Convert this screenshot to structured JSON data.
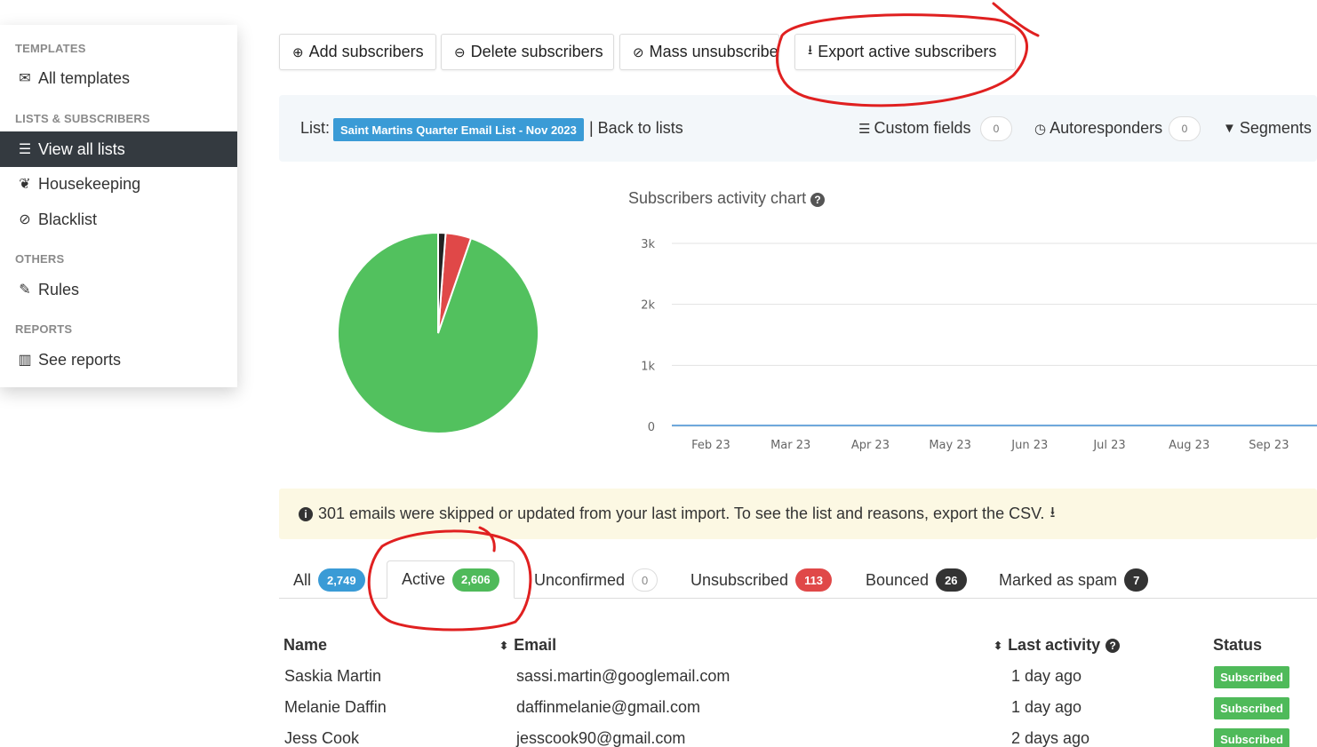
{
  "sidebar": {
    "sections": [
      {
        "heading": "TEMPLATES",
        "items": [
          {
            "label": "All templates",
            "icon": "envelope-icon"
          }
        ]
      },
      {
        "heading": "LISTS & SUBSCRIBERS",
        "items": [
          {
            "label": "View all lists",
            "icon": "list-icon",
            "active": true
          },
          {
            "label": "Housekeeping",
            "icon": "leaf-icon"
          },
          {
            "label": "Blacklist",
            "icon": "ban-icon"
          }
        ]
      },
      {
        "heading": "OTHERS",
        "items": [
          {
            "label": "Rules",
            "icon": "magic-wand-icon"
          }
        ]
      },
      {
        "heading": "REPORTS",
        "items": [
          {
            "label": "See reports",
            "icon": "bar-chart-icon"
          }
        ]
      }
    ]
  },
  "toolbar": {
    "add": "Add subscribers",
    "delete": "Delete subscribers",
    "mass_unsubscribe": "Mass unsubscribe",
    "export": "Export active subscribers"
  },
  "listbar": {
    "list_label": "List:",
    "list_name": "Saint Martins Quarter Email List - Nov 2023",
    "back": "| Back to lists",
    "custom_fields": "Custom fields",
    "custom_fields_count": "0",
    "autoresponders": "Autoresponders",
    "autoresponders_count": "0",
    "segments": "Segments"
  },
  "chart_data": [
    {
      "type": "pie",
      "categories": [
        "Active",
        "Unsubscribed",
        "Bounced + Marked as spam"
      ],
      "values": [
        2606,
        113,
        33
      ],
      "colors": [
        "#52c15e",
        "#e04848",
        "#222222"
      ]
    },
    {
      "type": "line",
      "title": "Subscribers activity chart",
      "categories": [
        "Feb 23",
        "Mar 23",
        "Apr 23",
        "May 23",
        "Jun 23",
        "Jul 23",
        "Aug 23",
        "Sep 23"
      ],
      "y_ticks": [
        "3k",
        "2k",
        "1k",
        "0"
      ],
      "ylim": [
        0,
        3000
      ],
      "series": [
        {
          "values": [
            0,
            0,
            0,
            0,
            0,
            0,
            0,
            0
          ],
          "color": "#6fa8dc"
        }
      ],
      "grid": true
    }
  ],
  "notice": "301 emails were skipped or updated from your last import. To see the list and reasons, export the CSV.",
  "tabs": [
    {
      "label": "All",
      "count": "2,749",
      "style": "blue"
    },
    {
      "label": "Active",
      "count": "2,606",
      "style": "green",
      "active": true
    },
    {
      "label": "Unconfirmed",
      "count": "0",
      "style": "empty"
    },
    {
      "label": "Unsubscribed",
      "count": "113",
      "style": "red"
    },
    {
      "label": "Bounced",
      "count": "26",
      "style": "dark"
    },
    {
      "label": "Marked as spam",
      "count": "7",
      "style": "dark"
    }
  ],
  "table": {
    "headers": {
      "name": "Name",
      "email": "Email",
      "last_activity": "Last activity",
      "status": "Status"
    },
    "rows": [
      {
        "name": "Saskia Martin",
        "email": "sassi.martin@googlemail.com",
        "last_activity": "1 day ago",
        "status": "Subscribed"
      },
      {
        "name": "Melanie Daffin",
        "email": "daffinmelanie@gmail.com",
        "last_activity": "1 day ago",
        "status": "Subscribed"
      },
      {
        "name": "Jess Cook",
        "email": "jesscook90@gmail.com",
        "last_activity": "2 days ago",
        "status": "Subscribed"
      }
    ]
  },
  "colors": {
    "accent": "#3a9bd6",
    "success": "#4fba5a",
    "danger": "#e04848",
    "annotation": "#e02020"
  }
}
